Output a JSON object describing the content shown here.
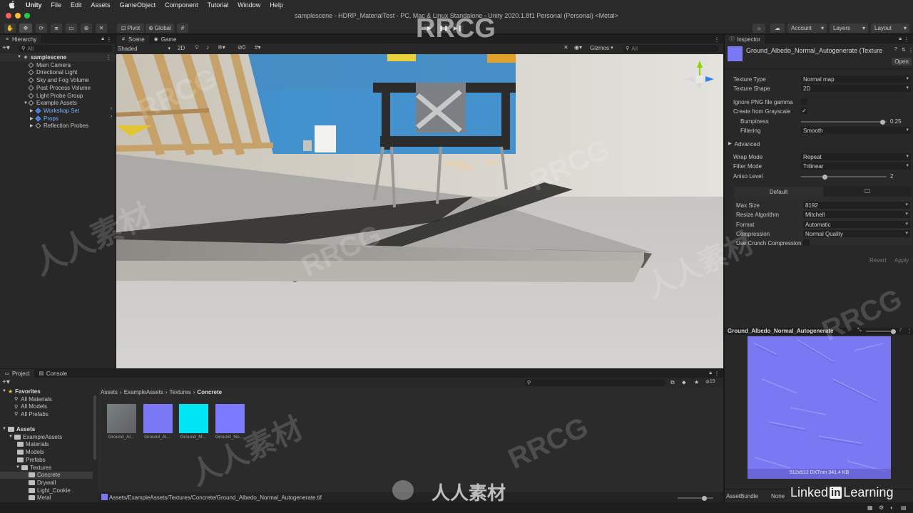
{
  "menubar": {
    "app_name": "Unity",
    "items": [
      "File",
      "Edit",
      "Assets",
      "GameObject",
      "Component",
      "Tutorial",
      "Window",
      "Help"
    ]
  },
  "window": {
    "title": "samplescene - HDRP_MaterialTest - PC, Mac & Linux Standalone - Unity 2020.1.8f1 Personal (Personal) <Metal>"
  },
  "toolbar": {
    "pivot_label": "Pivot",
    "global_label": "Global",
    "account_label": "Account",
    "layers_label": "Layers",
    "layout_label": "Layout"
  },
  "hierarchy": {
    "tab_label": "Hierarchy",
    "search_placeholder": "All",
    "scene_name": "samplescene",
    "items": [
      {
        "label": "Main Camera",
        "indent": 1
      },
      {
        "label": "Directional Light",
        "indent": 1
      },
      {
        "label": "Sky and Fog Volume",
        "indent": 1
      },
      {
        "label": "Post Process Volume",
        "indent": 1
      },
      {
        "label": "Light Probe Group",
        "indent": 1
      },
      {
        "label": "Example Assets",
        "indent": 1
      },
      {
        "label": "Workshop Set",
        "indent": 2
      },
      {
        "label": "Props",
        "indent": 2
      },
      {
        "label": "Reflection Probes",
        "indent": 2
      }
    ]
  },
  "scene_view": {
    "tab_scene": "Scene",
    "tab_game": "Game",
    "shading_mode": "Shaded",
    "mode_2d": "2D",
    "gizmos_label": "Gizmos",
    "search_placeholder": "All",
    "hidden_count": "0"
  },
  "inspector": {
    "tab_label": "Inspector",
    "asset_title": "Ground_Albedo_Normal_Autogenerate (Texture",
    "open_button": "Open",
    "texture_type_label": "Texture Type",
    "texture_type_value": "Normal map",
    "texture_shape_label": "Texture Shape",
    "texture_shape_value": "2D",
    "ignore_png_label": "Ignore PNG file gamma",
    "create_grayscale_label": "Create from Grayscale",
    "bumpiness_label": "Bumpiness",
    "bumpiness_value": "0.25",
    "bumpiness_fraction": 0.25,
    "filtering_label": "Filtering",
    "filtering_value": "Smooth",
    "advanced_label": "Advanced",
    "wrap_mode_label": "Wrap Mode",
    "wrap_mode_value": "Repeat",
    "filter_mode_label": "Filter Mode",
    "filter_mode_value": "Trilinear",
    "aniso_label": "Aniso Level",
    "aniso_value": "2",
    "aniso_fraction": 0.125,
    "platform_default_tab": "Default",
    "max_size_label": "Max Size",
    "max_size_value": "8192",
    "resize_label": "Resize Algorithm",
    "resize_value": "Mitchell",
    "format_label": "Format",
    "format_value": "Automatic",
    "compression_label": "Compression",
    "compression_value": "Normal Quality",
    "crunch_label": "Use Crunch Compression",
    "revert_button": "Revert",
    "apply_button": "Apply",
    "preview_title": "Ground_Albedo_Normal_Autogenerate",
    "preview_info": "512x512  DXTnm  341.4 KB",
    "assetbundle_label": "AssetBundle",
    "assetbundle_value": "None"
  },
  "project": {
    "tab_project": "Project",
    "tab_console": "Console",
    "favorites_label": "Favorites",
    "favorites": [
      "All Materials",
      "All Models",
      "All Prefabs"
    ],
    "assets_label": "Assets",
    "tree": [
      {
        "label": "ExampleAssets",
        "indent": 1
      },
      {
        "label": "Materials",
        "indent": 2
      },
      {
        "label": "Models",
        "indent": 2
      },
      {
        "label": "Prefabs",
        "indent": 2
      },
      {
        "label": "Textures",
        "indent": 2
      },
      {
        "label": "Concrete",
        "indent": 3
      },
      {
        "label": "Drywall",
        "indent": 3
      },
      {
        "label": "Light_Cookie",
        "indent": 3
      },
      {
        "label": "Metal",
        "indent": 3
      }
    ],
    "breadcrumb": [
      "Assets",
      "ExampleAssets",
      "Textures",
      "Concrete"
    ],
    "assets": [
      {
        "label": "Ground_Al...",
        "color": "#6d7274"
      },
      {
        "label": "Ground_Al...",
        "color": "#7a78f5"
      },
      {
        "label": "Ground_M...",
        "color": "#00e6f5"
      },
      {
        "label": "Ground_No...",
        "color": "#7c7bff"
      }
    ],
    "hidden_count": "15",
    "status_path": "Assets/ExampleAssets/Textures/Concrete/Ground_Albedo_Normal_Autogenerate.tif"
  },
  "watermarks": {
    "rrcg": "RRCG",
    "cn": "人人素材",
    "footer_cn": "人人素材",
    "linkedin_pre": "Linked",
    "linkedin_in": "in",
    "linkedin_post": " Learning"
  },
  "colors": {
    "accent_blue": "#3c78d8",
    "normal_map": "#7a78f5"
  }
}
